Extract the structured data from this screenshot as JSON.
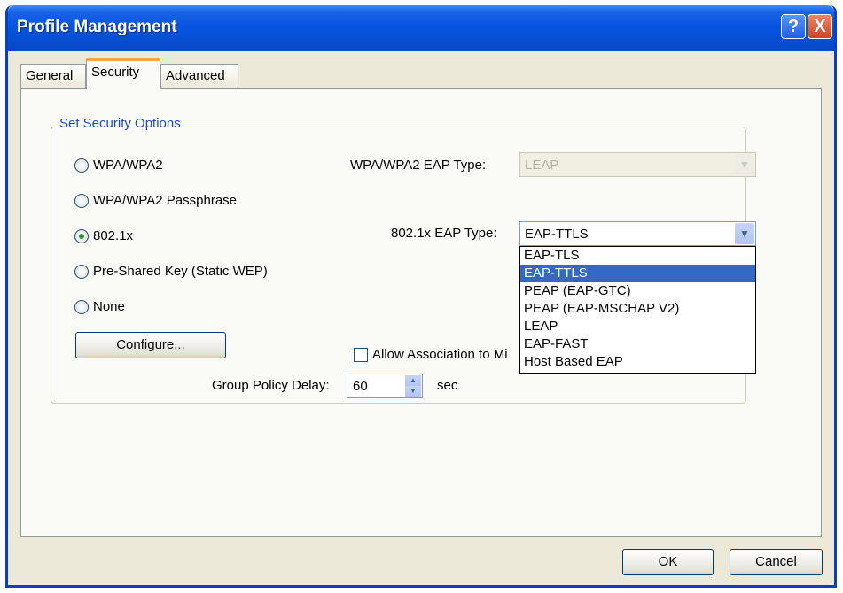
{
  "window": {
    "title": "Profile Management",
    "help_label": "?",
    "close_label": "X"
  },
  "tabs": [
    {
      "label": "General"
    },
    {
      "label": "Security"
    },
    {
      "label": "Advanced"
    }
  ],
  "security": {
    "group_label": "Set Security Options",
    "radios": [
      {
        "label": "WPA/WPA2",
        "selected": false
      },
      {
        "label": "WPA/WPA2 Passphrase",
        "selected": false
      },
      {
        "label": "802.1x",
        "selected": true
      },
      {
        "label": "Pre-Shared Key (Static WEP)",
        "selected": false
      },
      {
        "label": "None",
        "selected": false
      }
    ],
    "configure_label": "Configure...",
    "wpa_eap_type_label": "WPA/WPA2 EAP Type:",
    "wpa_eap_type_value": "LEAP",
    "eap_type_label": "802.1x EAP Type:",
    "eap_type_value": "EAP-TTLS",
    "eap_options": [
      "EAP-TLS",
      "EAP-TTLS",
      "PEAP (EAP-GTC)",
      "PEAP (EAP-MSCHAP V2)",
      "LEAP",
      "EAP-FAST",
      "Host Based EAP"
    ],
    "eap_selected_index": 1,
    "allow_assoc_label": "Allow Association to Mi",
    "group_policy_label": "Group Policy Delay:",
    "group_policy_value": "60",
    "group_policy_unit": "sec"
  },
  "footer": {
    "ok_label": "OK",
    "cancel_label": "Cancel"
  },
  "colors": {
    "titlebar": "#0755df",
    "legend_text": "#1d48c4",
    "list_highlight": "#316ac5",
    "tab_highlight": "#f2a93a"
  }
}
